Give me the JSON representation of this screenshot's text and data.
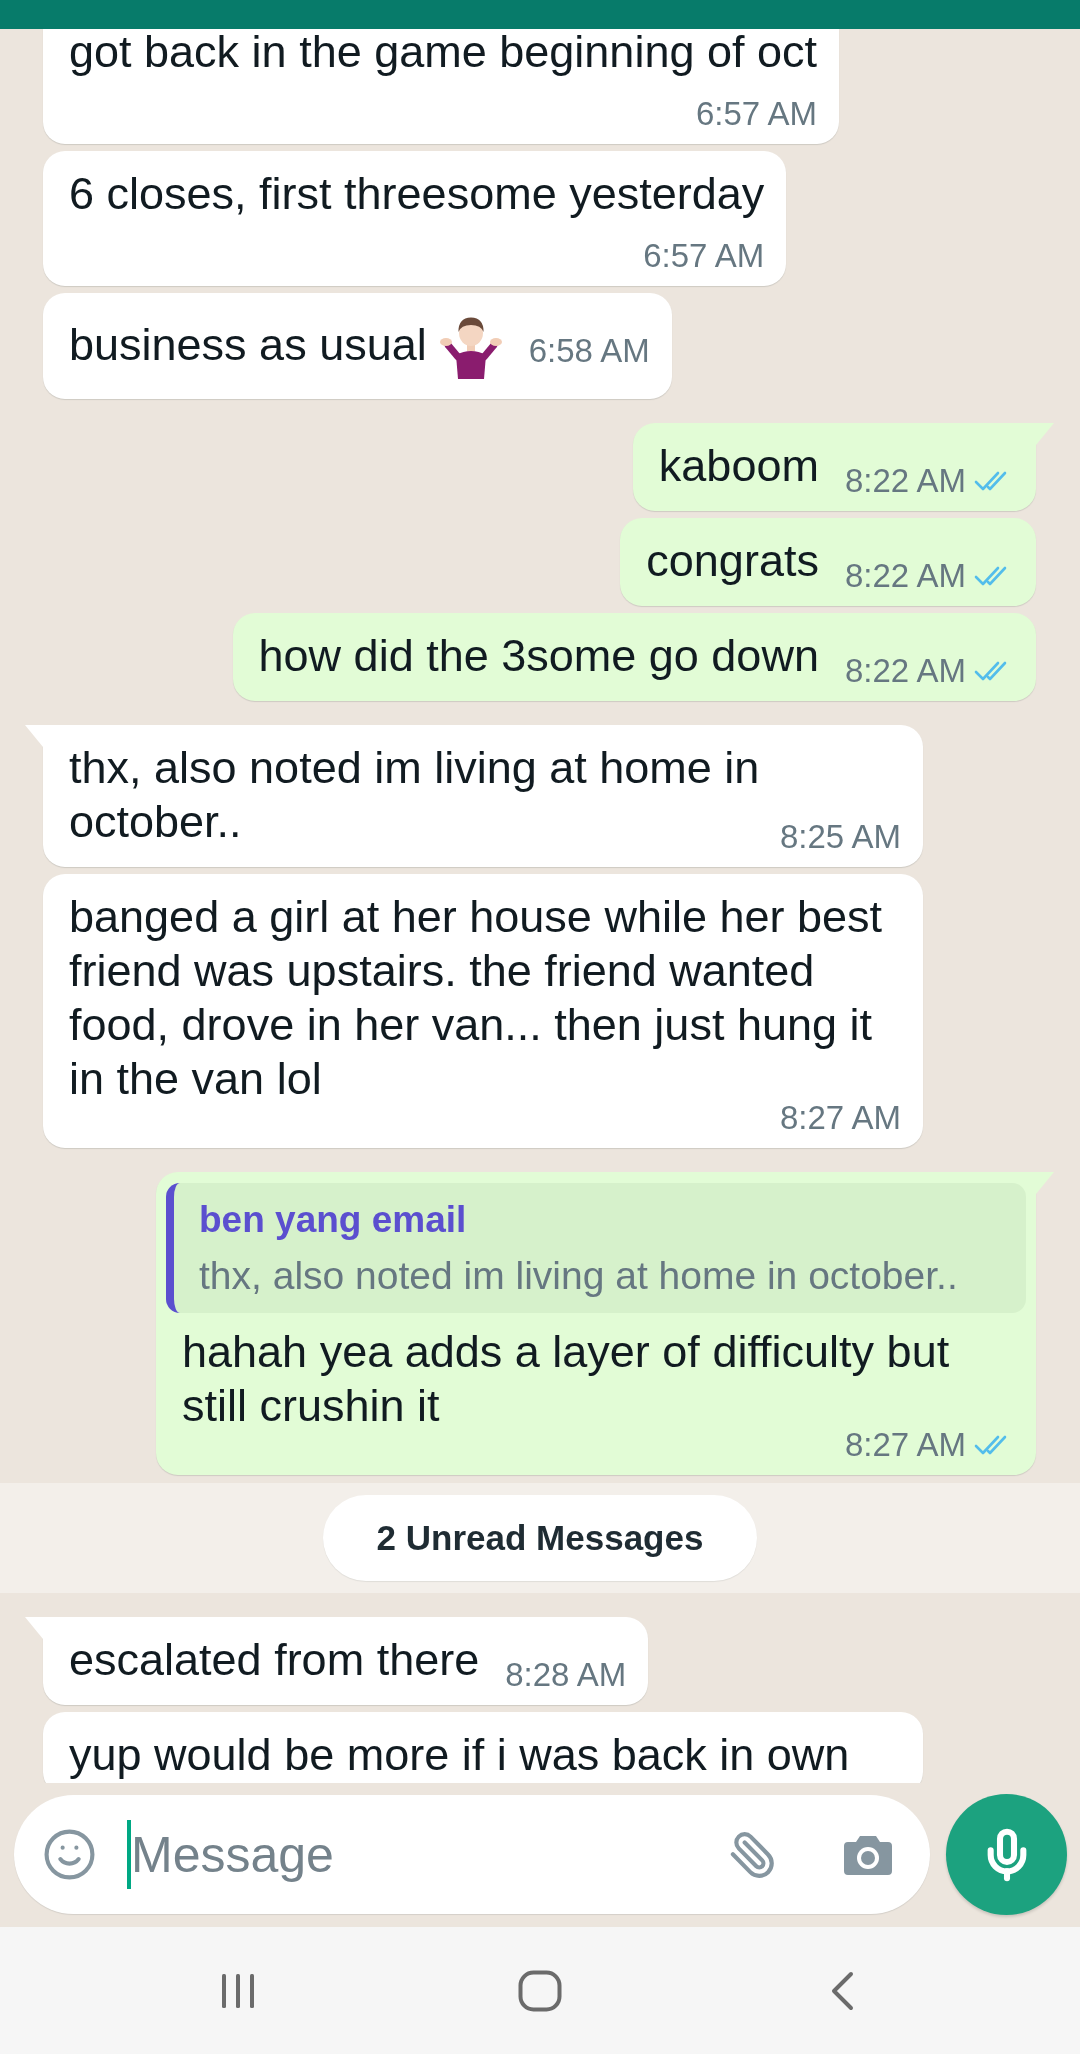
{
  "messages": [
    {
      "kind": "incoming",
      "text": "got back in the game beginning of oct",
      "time": "6:57 AM",
      "tail": false
    },
    {
      "kind": "incoming",
      "text": "6 closes, first threesome yesterday",
      "time": "6:57 AM",
      "tail": false
    },
    {
      "kind": "incoming",
      "text": "business as usual",
      "emoji": true,
      "time": "6:58 AM",
      "tail": false
    },
    {
      "kind": "outgoing",
      "text": "kaboom",
      "time": "8:22 AM",
      "read": true,
      "tail": true
    },
    {
      "kind": "outgoing",
      "text": "congrats",
      "time": "8:22 AM",
      "read": true,
      "tail": false
    },
    {
      "kind": "outgoing",
      "text": "how did the 3some go down",
      "time": "8:22 AM",
      "read": true,
      "tail": false
    },
    {
      "kind": "incoming",
      "text": "thx, also noted im living at home in october..",
      "time": "8:25 AM",
      "tail": true
    },
    {
      "kind": "incoming",
      "text": "banged a girl at her house while her best friend was upstairs. the friend wanted food, drove in her van... then just hung it in the van lol",
      "time": "8:27 AM",
      "tail": false
    },
    {
      "kind": "outgoing",
      "quote": {
        "author": "ben yang email",
        "text": "thx, also noted im living at home in october.."
      },
      "text": "hahah yea adds a layer of difficulty but still crushin it",
      "time": "8:27 AM",
      "read": true,
      "tail": true
    },
    {
      "kind": "unread_divider",
      "text": "2 Unread Messages"
    },
    {
      "kind": "incoming",
      "text": "escalated from there",
      "time": "8:28 AM",
      "tail": true
    },
    {
      "kind": "incoming",
      "text": "yup would be more if i was back in own",
      "tail": false,
      "cut_off": true
    }
  ],
  "composer": {
    "placeholder": "Message",
    "focused": true
  }
}
